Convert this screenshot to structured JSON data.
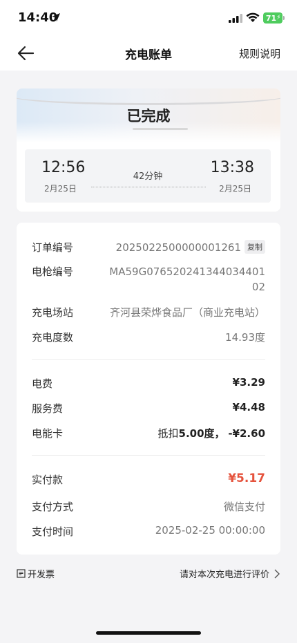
{
  "status_bar": {
    "time": "14:40",
    "battery": "71",
    "icons": [
      "location-arrow-icon",
      "signal-icon",
      "wifi-icon",
      "battery-icon"
    ]
  },
  "nav": {
    "back_icon": "back-arrow-icon",
    "title": "充电账单",
    "rules_label": "规则说明"
  },
  "status_card": {
    "status": "已完成",
    "start_time": "12:56",
    "start_date": "2月25日",
    "duration": "42分钟",
    "end_time": "13:38",
    "end_date": "2月25日"
  },
  "details": {
    "order_no_label": "订单编号",
    "order_no": "2025022500000001261",
    "copy_label": "复制",
    "gun_no_label": "电枪编号",
    "gun_no": "MA59G07652024134403440102",
    "station_label": "充电场站",
    "station": "齐河县荣烨食品厂（商业充电站）",
    "kwh_label": "充电度数",
    "kwh": "14.93度",
    "elec_fee_label": "电费",
    "elec_fee": "¥3.29",
    "service_fee_label": "服务费",
    "service_fee": "¥4.48",
    "energy_card_label": "电能卡",
    "energy_card_prefix": "抵扣",
    "energy_card_amount": "5.00度，",
    "energy_card_value": "-¥2.60",
    "paid_label": "实付款",
    "paid": "¥5.17",
    "pay_method_label": "支付方式",
    "pay_method": "微信支付",
    "pay_time_label": "支付时间",
    "pay_time": "2025-02-25 00:00:00"
  },
  "bottom": {
    "invoice_label": "开发票",
    "evaluate_label": "请对本次充电进行评价"
  },
  "colors": {
    "accent_red": "#e5533d",
    "battery_green": "#4fcc5e",
    "background": "#f4f4f6"
  }
}
